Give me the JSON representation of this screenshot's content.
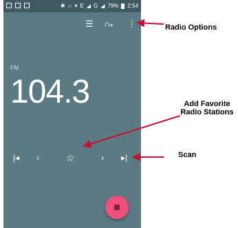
{
  "status_bar": {
    "battery": "79%",
    "time": "2:54",
    "network": "E",
    "network2": "G"
  },
  "toolbar": {
    "list_icon": "list-icon",
    "headset_icon": "headset-icon",
    "menu_icon": "more-vert-icon"
  },
  "radio": {
    "band": "FM",
    "frequency": "104.3"
  },
  "controls": {
    "skip_prev": "skip-previous-icon",
    "prev": "chevron-left-icon",
    "favorite": "star-outline-icon",
    "next": "chevron-right-icon",
    "skip_next": "skip-next-icon",
    "fab": "stop-icon"
  },
  "annotations": {
    "radio_options": "Radio Options",
    "add_favorite": "Add Favorite Radio Stations",
    "scan": "Scan"
  },
  "colors": {
    "screen_bg": "#5b7a83",
    "status_bg": "#3f5a61",
    "fab": "#ef4f7d",
    "arrow": "#c8102e"
  }
}
